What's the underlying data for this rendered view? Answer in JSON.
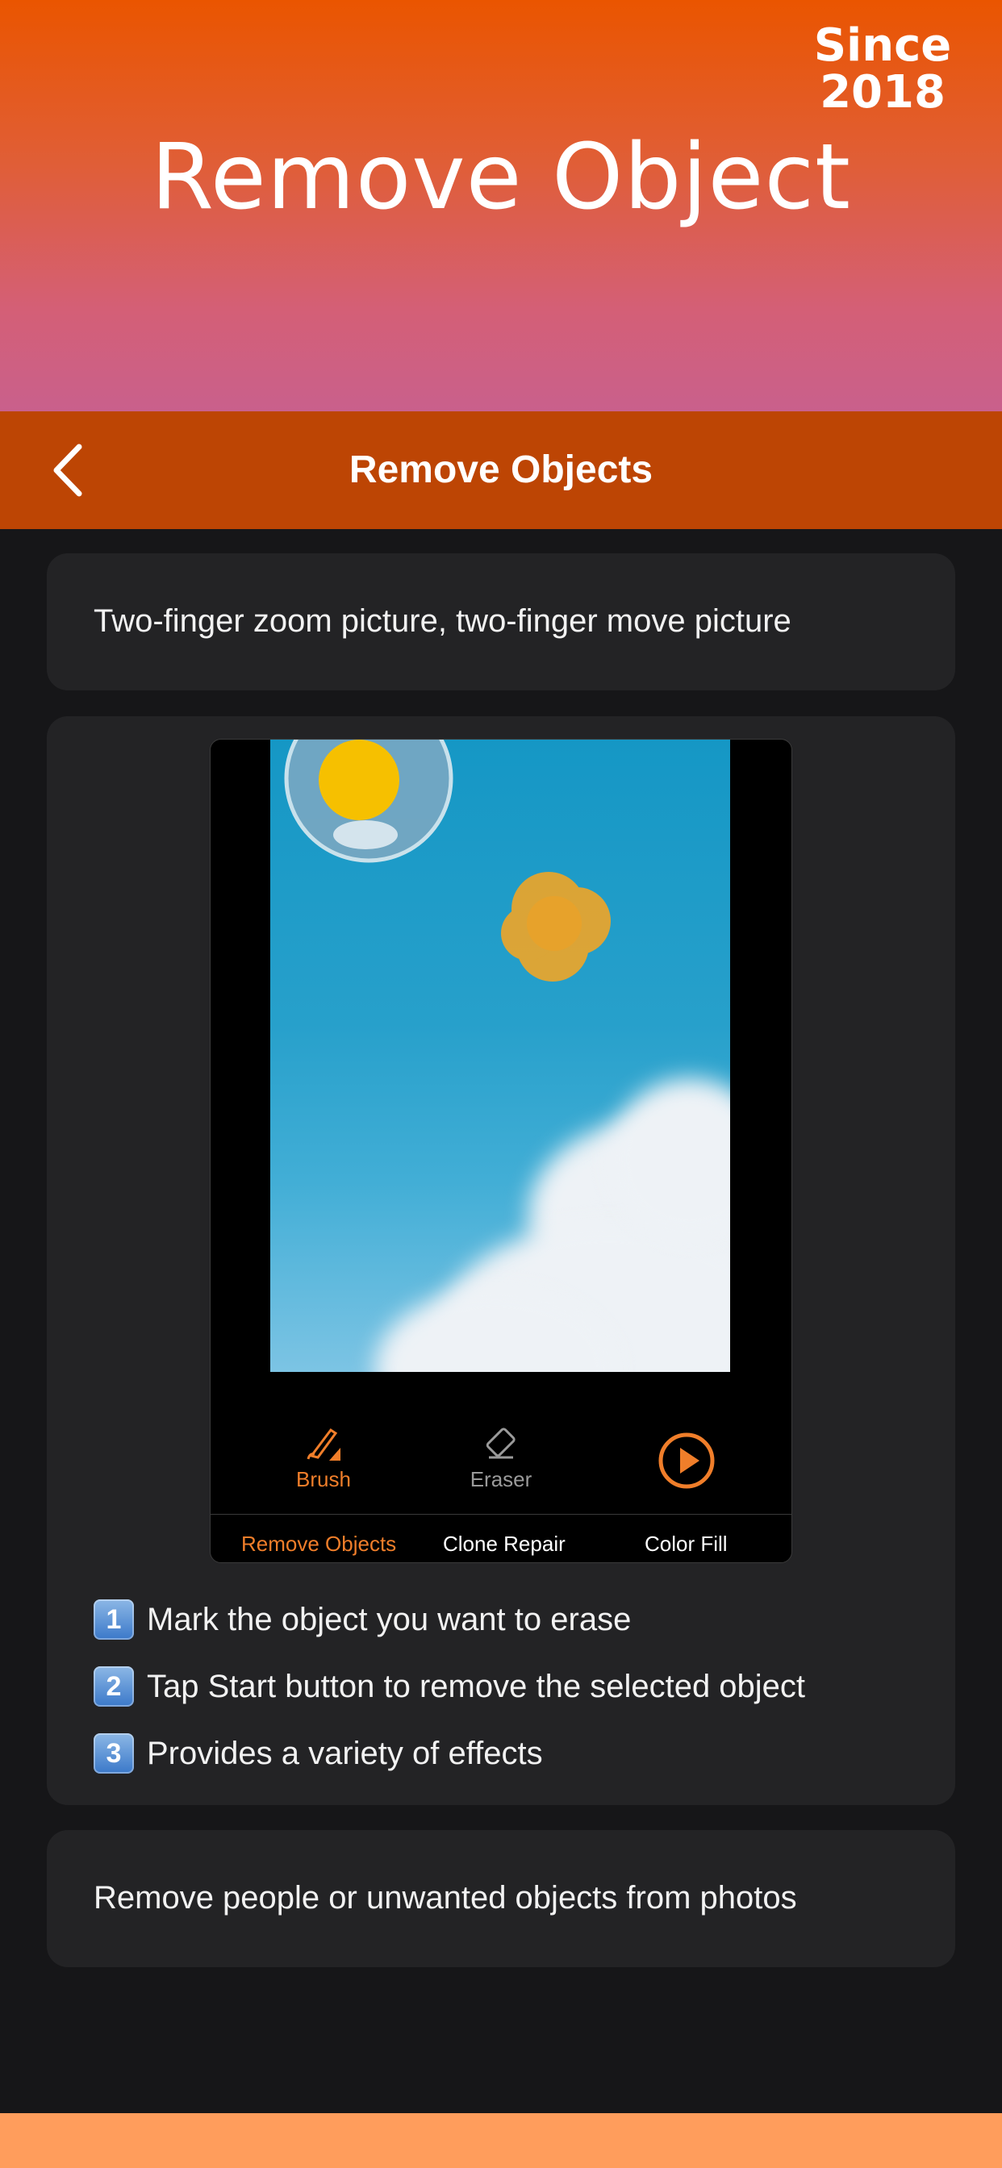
{
  "promo": {
    "since": "Since 2018",
    "title": "Remove Object"
  },
  "navbar": {
    "back_icon": "chevron-left-icon",
    "title": "Remove Objects"
  },
  "card_zoom": {
    "text": "Two-finger zoom picture, two-finger move picture"
  },
  "preview": {
    "toolbar": [
      {
        "label": "Brush",
        "icon": "brush-icon",
        "active": true
      },
      {
        "label": "Eraser",
        "icon": "eraser-icon",
        "active": false
      },
      {
        "label": "",
        "icon": "play-icon",
        "active": true
      }
    ],
    "tabs": [
      {
        "label": "Remove Objects",
        "active": true
      },
      {
        "label": "Clone Repair",
        "active": false
      },
      {
        "label": "Color Fill",
        "active": false
      }
    ]
  },
  "steps": [
    {
      "badge": "1",
      "text": "Mark the object you want to erase"
    },
    {
      "badge": "2",
      "text": "Tap Start button to remove the selected object"
    },
    {
      "badge": "3",
      "text": "Provides a variety of effects"
    }
  ],
  "card_remove": {
    "text": "Remove people or unwanted objects from photos"
  },
  "colors": {
    "accent": "#f07e2a",
    "navbar": "#bd4504",
    "background": "#161618",
    "card": "#232325"
  }
}
